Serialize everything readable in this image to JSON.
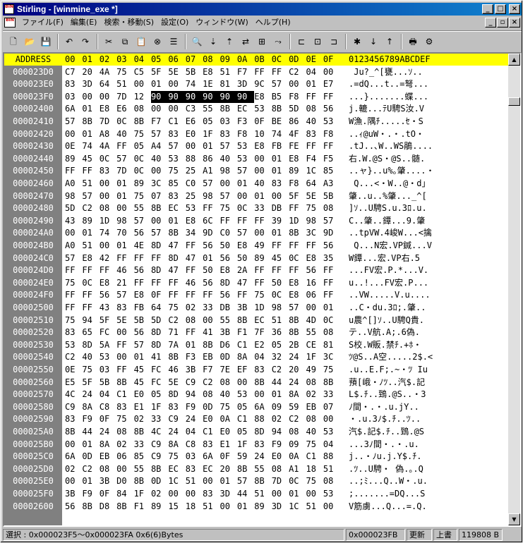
{
  "window": {
    "title": "Stirling - [winmine_exe *]",
    "app_icon_text": "BIN"
  },
  "title_buttons": [
    "_",
    "□",
    "×"
  ],
  "menubar": {
    "items": [
      "ファイル(F)",
      "編集(E)",
      "検索・移動(S)",
      "設定(O)",
      "ウィンドウ(W)",
      "ヘルプ(H)"
    ],
    "mdi_buttons": [
      "_",
      "▫",
      "×"
    ]
  },
  "toolbar": {
    "icons": [
      "new-file-icon",
      "open-folder-icon",
      "save-icon",
      "|",
      "undo-icon",
      "redo-icon",
      "|",
      "cut-icon",
      "copy-icon",
      "paste-icon",
      "delete-icon",
      "list-icon",
      "|",
      "find-icon",
      "find-next-icon",
      "find-prev-icon",
      "replace-icon",
      "compare-icon",
      "jump-icon",
      "|",
      "insert-icon",
      "fill-icon",
      "append-icon",
      "|",
      "mark-icon",
      "next-mark-icon",
      "prev-mark-icon",
      "|",
      "print-icon",
      "settings-icon"
    ],
    "glyphs": {
      "new-file-icon": "🗋",
      "open-folder-icon": "📂",
      "save-icon": "💾",
      "undo-icon": "↶",
      "redo-icon": "↷",
      "cut-icon": "✂",
      "copy-icon": "⧉",
      "paste-icon": "📋",
      "delete-icon": "⊗",
      "list-icon": "☰",
      "find-icon": "🔍",
      "find-next-icon": "⇣",
      "find-prev-icon": "⇡",
      "replace-icon": "⇄",
      "compare-icon": "⊞",
      "jump-icon": "⤳",
      "insert-icon": "⊏",
      "fill-icon": "⊡",
      "append-icon": "⊐",
      "mark-icon": "✱",
      "next-mark-icon": "↓",
      "prev-mark-icon": "↑",
      "print-icon": "🖶",
      "settings-icon": "⚙"
    }
  },
  "hex": {
    "header": {
      "addr": "ADDRESS",
      "bytes": [
        "00",
        "01",
        "02",
        "03",
        "04",
        "05",
        "06",
        "07",
        "08",
        "09",
        "0A",
        "0B",
        "0C",
        "0D",
        "0E",
        "0F"
      ],
      "ascii": "0123456789ABCDEF"
    },
    "rows": [
      {
        "addr": "000023D0",
        "bytes": [
          "C7",
          "20",
          "4A",
          "75",
          "C5",
          "5F",
          "5E",
          "5B",
          "E8",
          "51",
          "F7",
          "FF",
          "FF",
          "C2",
          "04",
          "00"
        ],
        "ascii": " Ju?_^[甕...ｿ.."
      },
      {
        "addr": "000023E0",
        "bytes": [
          "83",
          "3D",
          "64",
          "51",
          "00",
          "01",
          "00",
          "74",
          "1E",
          "81",
          "3D",
          "9C",
          "57",
          "00",
          "01",
          "E7"
        ],
        "ascii": ".=dQ...t..=弩..."
      },
      {
        "addr": "000023F0",
        "bytes": [
          "03",
          "00",
          "00",
          "7D",
          "12",
          "90",
          "90",
          "90",
          "90",
          "90",
          "90",
          "E8",
          "B5",
          "F8",
          "FF",
          "FF"
        ],
        "ascii": "...}.......蝶..."
      },
      {
        "addr": "00002400",
        "bytes": [
          "6A",
          "01",
          "E8",
          "E6",
          "08",
          "00",
          "00",
          "C3",
          "55",
          "8B",
          "EC",
          "53",
          "8B",
          "5D",
          "08",
          "56"
        ],
        "ascii": "j.轆...ﾃU騁S汝.V"
      },
      {
        "addr": "00002410",
        "bytes": [
          "57",
          "8B",
          "7D",
          "0C",
          "8B",
          "F7",
          "C1",
          "E6",
          "05",
          "03",
          "F3",
          "0F",
          "BE",
          "86",
          "40",
          "53"
        ],
        "ascii": "W漁.隅ﾁ.....ｾ・S"
      },
      {
        "addr": "00002420",
        "bytes": [
          "00",
          "01",
          "A8",
          "40",
          "75",
          "57",
          "83",
          "E0",
          "1F",
          "83",
          "F8",
          "10",
          "74",
          "4F",
          "83",
          "F8"
        ],
        "ascii": "..ｨ@uW・.・.tO・"
      },
      {
        "addr": "00002430",
        "bytes": [
          "0E",
          "74",
          "4A",
          "FF",
          "05",
          "A4",
          "57",
          "00",
          "01",
          "57",
          "53",
          "E8",
          "FB",
          "FE",
          "FF",
          "FF"
        ],
        "ascii": ".tJ..､W..WS鵑...."
      },
      {
        "addr": "00002440",
        "bytes": [
          "89",
          "45",
          "0C",
          "57",
          "0C",
          "40",
          "53",
          "88",
          "86",
          "40",
          "53",
          "00",
          "01",
          "E8",
          "F4",
          "F5"
        ],
        "ascii": "右.W.@S・@S..髄."
      },
      {
        "addr": "00002450",
        "bytes": [
          "FF",
          "FF",
          "83",
          "7D",
          "0C",
          "00",
          "75",
          "25",
          "A1",
          "98",
          "57",
          "00",
          "01",
          "89",
          "1C",
          "85"
        ],
        "ascii": "..ャ}..u%｡肇....・"
      },
      {
        "addr": "00002460",
        "bytes": [
          "A0",
          "51",
          "00",
          "01",
          "89",
          "3C",
          "85",
          "C0",
          "57",
          "00",
          "01",
          "40",
          "83",
          "F8",
          "64",
          "A3"
        ],
        "ascii": " Q...<・W..@・d｣"
      },
      {
        "addr": "00002470",
        "bytes": [
          "98",
          "57",
          "00",
          "01",
          "75",
          "07",
          "83",
          "25",
          "98",
          "57",
          "00",
          "01",
          "00",
          "5F",
          "5E",
          "5B"
        ],
        "ascii": "肇..u..%肇..._^["
      },
      {
        "addr": "00002480",
        "bytes": [
          "5D",
          "C2",
          "08",
          "00",
          "55",
          "8B",
          "EC",
          "53",
          "FF",
          "75",
          "0C",
          "33",
          "DB",
          "FF",
          "75",
          "08"
        ],
        "ascii": "]ｿ..U騁S.u.3ﾛ.u."
      },
      {
        "addr": "00002490",
        "bytes": [
          "43",
          "89",
          "1D",
          "98",
          "57",
          "00",
          "01",
          "E8",
          "6C",
          "FF",
          "FF",
          "FF",
          "39",
          "1D",
          "98",
          "57"
        ],
        "ascii": "C..肇..鐔...9.肇"
      },
      {
        "addr": "000024A0",
        "bytes": [
          "00",
          "01",
          "74",
          "70",
          "56",
          "57",
          "8B",
          "34",
          "9D",
          "C0",
          "57",
          "00",
          "01",
          "8B",
          "3C",
          "9D"
        ],
        "ascii": "..tpVW.4峻W...<擒"
      },
      {
        "addr": "000024B0",
        "bytes": [
          "A0",
          "51",
          "00",
          "01",
          "4E",
          "8D",
          "47",
          "FF",
          "56",
          "50",
          "E8",
          "49",
          "FF",
          "FF",
          "FF",
          "56"
        ],
        "ascii": " Q...N宏.VP鍼...V"
      },
      {
        "addr": "000024C0",
        "bytes": [
          "57",
          "E8",
          "42",
          "FF",
          "FF",
          "FF",
          "8D",
          "47",
          "01",
          "56",
          "50",
          "89",
          "45",
          "0C",
          "E8",
          "35"
        ],
        "ascii": "W鐔...宏.VP右.5"
      },
      {
        "addr": "000024D0",
        "bytes": [
          "FF",
          "FF",
          "FF",
          "46",
          "56",
          "8D",
          "47",
          "FF",
          "50",
          "E8",
          "2A",
          "FF",
          "FF",
          "FF",
          "56",
          "FF"
        ],
        "ascii": "...FV宏.P.*...V."
      },
      {
        "addr": "000024E0",
        "bytes": [
          "75",
          "0C",
          "E8",
          "21",
          "FF",
          "FF",
          "FF",
          "46",
          "56",
          "8D",
          "47",
          "FF",
          "50",
          "E8",
          "16",
          "FF"
        ],
        "ascii": "u..!...FV宏.P..."
      },
      {
        "addr": "000024F0",
        "bytes": [
          "FF",
          "FF",
          "56",
          "57",
          "E8",
          "0F",
          "FF",
          "FF",
          "FF",
          "56",
          "FF",
          "75",
          "0C",
          "E8",
          "06",
          "FF"
        ],
        "ascii": "..VW.....V.u...."
      },
      {
        "addr": "00002500",
        "bytes": [
          "FF",
          "FF",
          "43",
          "83",
          "FB",
          "64",
          "75",
          "02",
          "33",
          "DB",
          "3B",
          "1D",
          "98",
          "57",
          "00",
          "01"
        ],
        "ascii": "..C・du.3ﾛ;.肇.."
      },
      {
        "addr": "00002510",
        "bytes": [
          "75",
          "94",
          "5F",
          "5E",
          "5B",
          "5D",
          "C2",
          "08",
          "00",
          "55",
          "8B",
          "EC",
          "51",
          "8B",
          "4D",
          "0C"
        ],
        "ascii": "u農^[]ｿ..U騁Q貴."
      },
      {
        "addr": "00002520",
        "bytes": [
          "83",
          "65",
          "FC",
          "00",
          "56",
          "8D",
          "71",
          "FF",
          "41",
          "3B",
          "F1",
          "7F",
          "36",
          "8B",
          "55",
          "08"
        ],
        "ascii": "テ..V航.A;.6偽."
      },
      {
        "addr": "00002530",
        "bytes": [
          "53",
          "8D",
          "5A",
          "FF",
          "57",
          "8D",
          "7A",
          "01",
          "8B",
          "D6",
          "C1",
          "E2",
          "05",
          "2B",
          "CE",
          "81"
        ],
        "ascii": "S校.W販.禁ﾁ.+ﾎ・"
      },
      {
        "addr": "00002540",
        "bytes": [
          "C2",
          "40",
          "53",
          "00",
          "01",
          "41",
          "8B",
          "F3",
          "EB",
          "0D",
          "8A",
          "04",
          "32",
          "24",
          "1F",
          "3C"
        ],
        "ascii": "ﾂ@S..A空.....2$.<"
      },
      {
        "addr": "00002550",
        "bytes": [
          "0E",
          "75",
          "03",
          "FF",
          "45",
          "FC",
          "46",
          "3B",
          "F7",
          "7E",
          "EF",
          "83",
          "C2",
          "20",
          "49",
          "75"
        ],
        "ascii": ".u..E.F;.~・ﾂ Iu"
      },
      {
        "addr": "00002560",
        "bytes": [
          "E5",
          "5F",
          "5B",
          "8B",
          "45",
          "FC",
          "5E",
          "C9",
          "C2",
          "08",
          "00",
          "8B",
          "44",
          "24",
          "08",
          "8B"
        ],
        "ascii": "蕷[峨・ﾉﾂ..汽$.記"
      },
      {
        "addr": "00002570",
        "bytes": [
          "4C",
          "24",
          "04",
          "C1",
          "E0",
          "05",
          "8D",
          "94",
          "08",
          "40",
          "53",
          "00",
          "01",
          "8A",
          "02",
          "33"
        ],
        "ascii": "L$.ﾁ..鵄.@S..・3"
      },
      {
        "addr": "00002580",
        "bytes": [
          "C9",
          "8A",
          "C8",
          "83",
          "E1",
          "1F",
          "83",
          "F9",
          "0D",
          "75",
          "05",
          "6A",
          "09",
          "59",
          "EB",
          "07"
        ],
        "ascii": "ﾉ間・.・.u.jY.."
      },
      {
        "addr": "00002590",
        "bytes": [
          "83",
          "F9",
          "0F",
          "75",
          "02",
          "33",
          "C9",
          "24",
          "E0",
          "0A",
          "C1",
          "88",
          "02",
          "C2",
          "08",
          "00"
        ],
        "ascii": "・.u.3ﾉ$.ﾁ..ﾂ.."
      },
      {
        "addr": "000025A0",
        "bytes": [
          "8B",
          "44",
          "24",
          "08",
          "8B",
          "4C",
          "24",
          "04",
          "C1",
          "E0",
          "05",
          "8D",
          "94",
          "08",
          "40",
          "53"
        ],
        "ascii": "汽$.記$.ﾁ..鵄.@S"
      },
      {
        "addr": "000025B0",
        "bytes": [
          "00",
          "01",
          "8A",
          "02",
          "33",
          "C9",
          "8A",
          "C8",
          "83",
          "E1",
          "1F",
          "83",
          "F9",
          "09",
          "75",
          "04"
        ],
        "ascii": "...3ﾉ間・.・.u."
      },
      {
        "addr": "000025C0",
        "bytes": [
          "6A",
          "0D",
          "EB",
          "06",
          "85",
          "C9",
          "75",
          "03",
          "6A",
          "0F",
          "59",
          "24",
          "E0",
          "0A",
          "C1",
          "88"
        ],
        "ascii": "j..・ﾉu.j.Y$.ﾁ."
      },
      {
        "addr": "000025D0",
        "bytes": [
          "02",
          "C2",
          "08",
          "00",
          "55",
          "8B",
          "EC",
          "83",
          "EC",
          "20",
          "8B",
          "55",
          "08",
          "A1",
          "18",
          "51"
        ],
        "ascii": ".ﾂ..U騁・ 偽.｡.Q"
      },
      {
        "addr": "000025E0",
        "bytes": [
          "00",
          "01",
          "3B",
          "D0",
          "8B",
          "0D",
          "1C",
          "51",
          "00",
          "01",
          "57",
          "8B",
          "7D",
          "0C",
          "75",
          "08"
        ],
        "ascii": "..;ﾐ...Q..W・.u."
      },
      {
        "addr": "000025F0",
        "bytes": [
          "3B",
          "F9",
          "0F",
          "84",
          "1F",
          "02",
          "00",
          "00",
          "83",
          "3D",
          "44",
          "51",
          "00",
          "01",
          "00",
          "53"
        ],
        "ascii": ";.......=DQ...S"
      },
      {
        "addr": "00002600",
        "bytes": [
          "56",
          "8B",
          "D8",
          "8B",
          "F1",
          "89",
          "15",
          "18",
          "51",
          "00",
          "01",
          "89",
          "3D",
          "1C",
          "51",
          "00"
        ],
        "ascii": "V筋虜...Q...=.Q."
      }
    ],
    "selection": {
      "row": 2,
      "start": 5,
      "end": 10
    }
  },
  "statusbar": {
    "selection_text": "選択 : 0x000023F5～0x000023FA  0x6(6)Bytes",
    "cursor": "0x000023FB",
    "mode": "更新",
    "insert": "上書",
    "size": "119808 B"
  }
}
